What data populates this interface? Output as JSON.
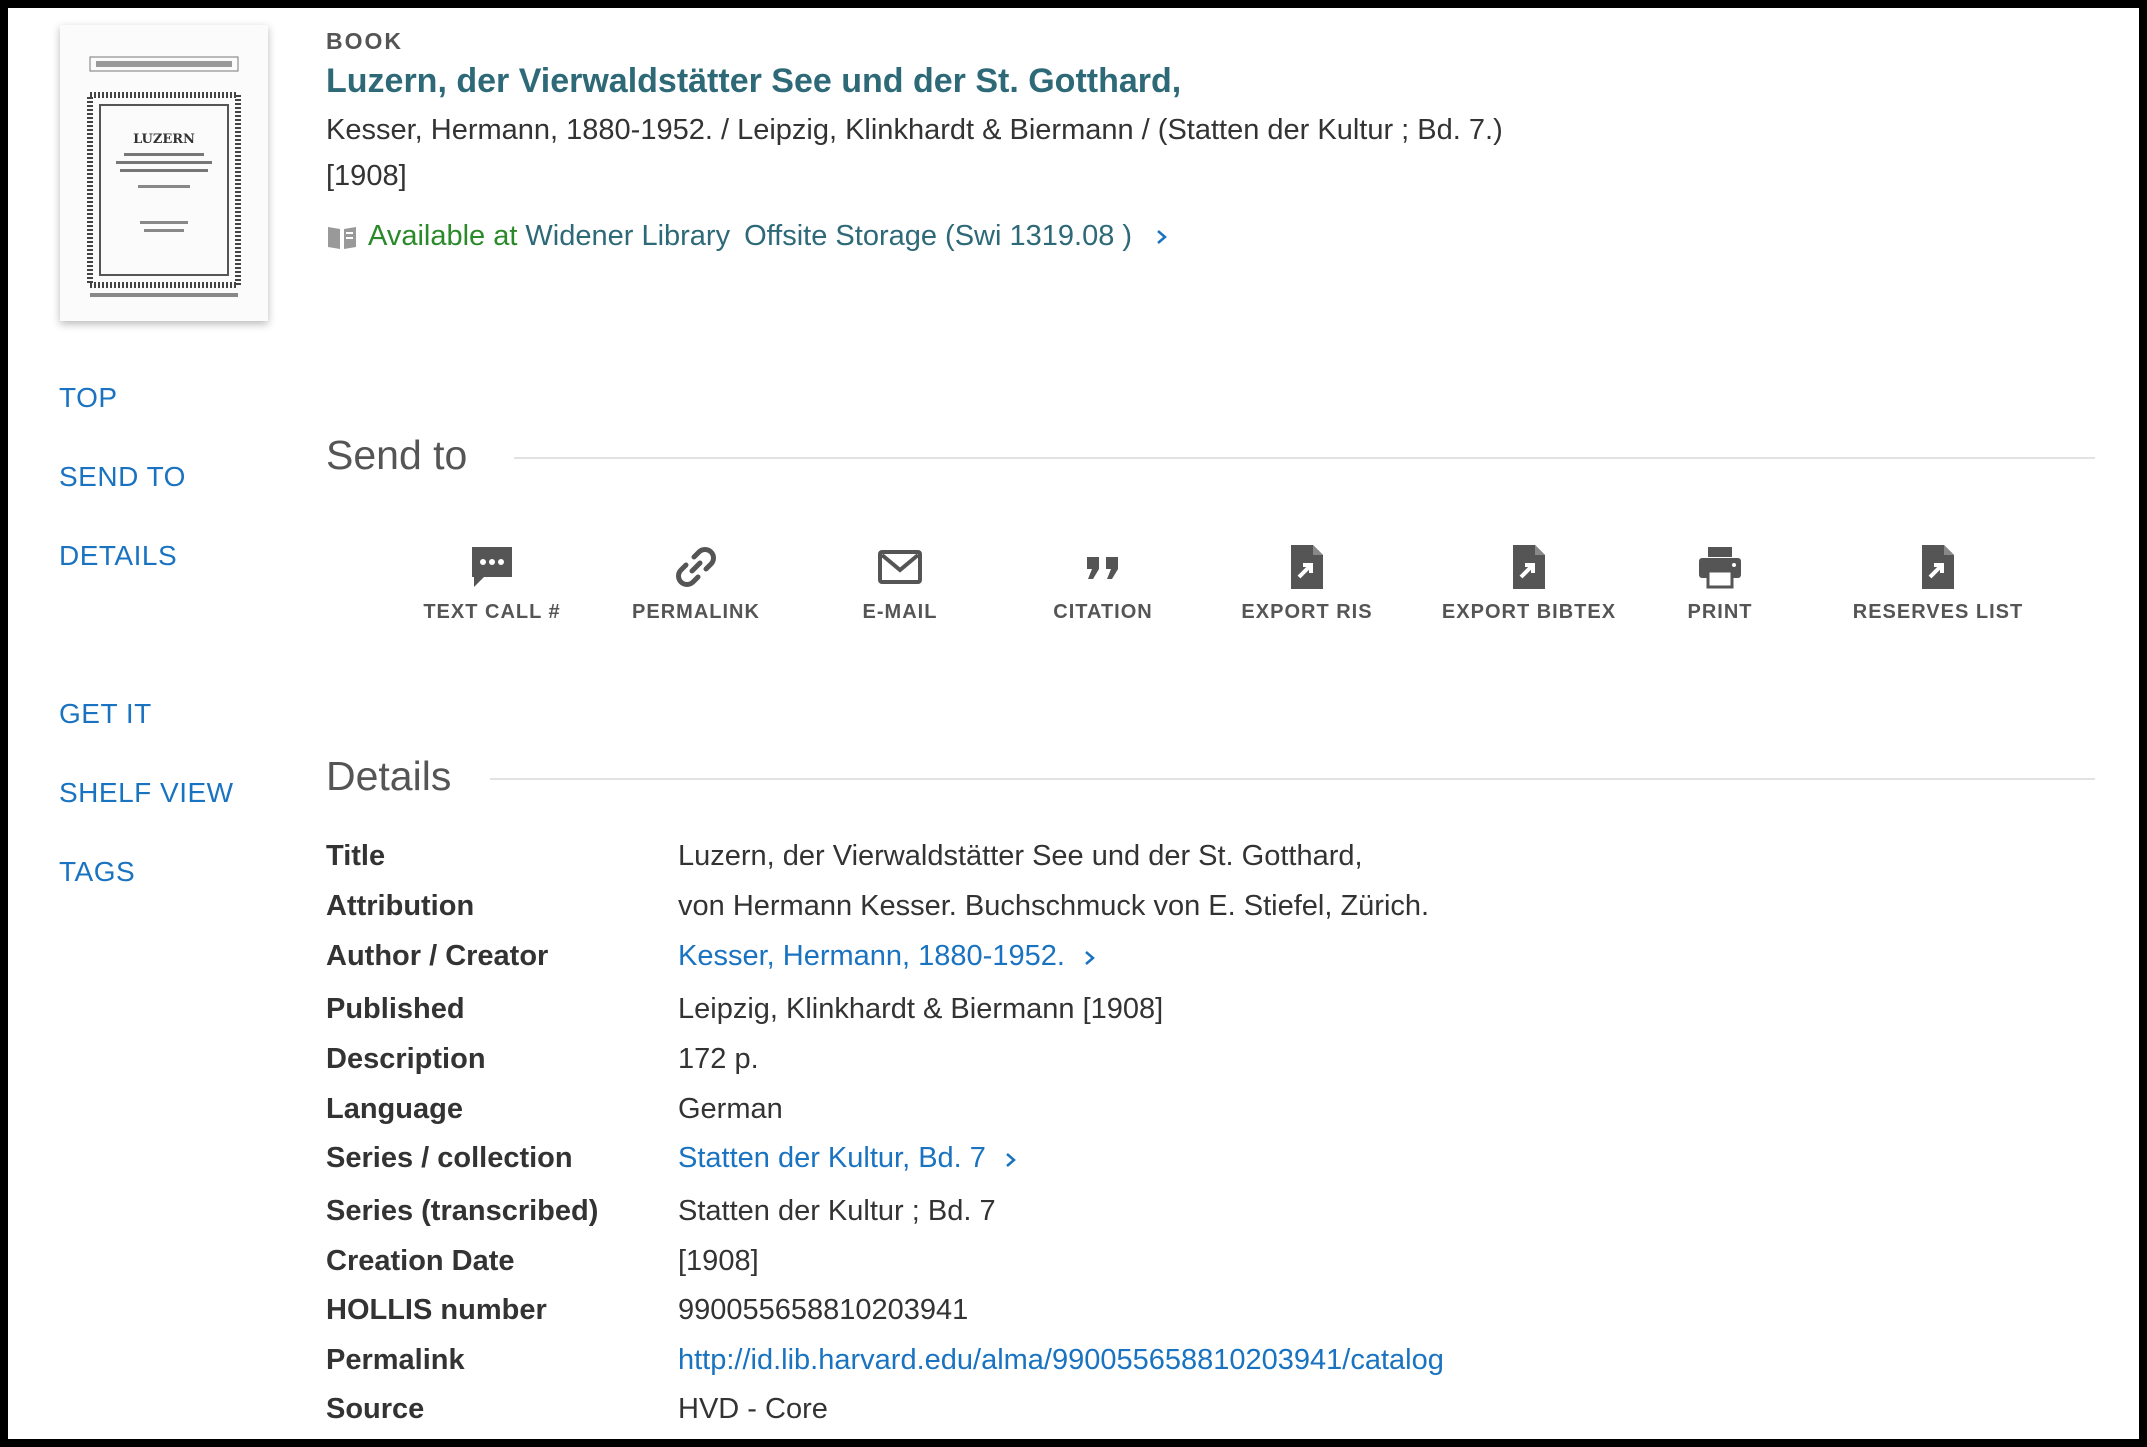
{
  "record": {
    "type": "BOOK",
    "title": "Luzern, der Vierwaldstätter See und der St. Gotthard,",
    "subline": "Kesser, Hermann, 1880-1952. / Leipzig, Klinkhardt & Biermann / (Statten der Kultur ; Bd. 7.)",
    "date": "[1908]",
    "availability": {
      "status": "Available at",
      "library": "Widener Library",
      "location": "Offsite Storage (Swi 1319.08 )"
    },
    "thumbnail_title": "LUZERN"
  },
  "nav": {
    "top": "TOP",
    "send_to": "SEND TO",
    "details": "DETAILS",
    "get_it": "GET IT",
    "shelf_view": "SHELF VIEW",
    "tags": "TAGS"
  },
  "send_to": {
    "heading": "Send to",
    "actions": [
      {
        "label": "TEXT CALL #",
        "icon": "chat-bubble-icon"
      },
      {
        "label": "PERMALINK",
        "icon": "link-icon"
      },
      {
        "label": "E-MAIL",
        "icon": "envelope-icon"
      },
      {
        "label": "CITATION",
        "icon": "quote-icon"
      },
      {
        "label": "EXPORT RIS",
        "icon": "file-export-icon"
      },
      {
        "label": "EXPORT BIBTEX",
        "icon": "file-export-icon"
      },
      {
        "label": "PRINT",
        "icon": "printer-icon"
      },
      {
        "label": "RESERVES LIST",
        "icon": "file-export-icon"
      }
    ]
  },
  "details": {
    "heading": "Details",
    "rows": [
      {
        "key": "Title",
        "value": "Luzern, der Vierwaldstätter See und der St. Gotthard,"
      },
      {
        "key": "Attribution",
        "value": "von Hermann Kesser. Buchschmuck von E. Stiefel, Zürich."
      },
      {
        "key": "Author / Creator",
        "value": "Kesser, Hermann, 1880-1952."
      },
      {
        "key": "Published",
        "value": "Leipzig, Klinkhardt & Biermann [1908]"
      },
      {
        "key": "Description",
        "value": "172 p."
      },
      {
        "key": "Language",
        "value": "German"
      },
      {
        "key": "Series / collection",
        "value": "Statten der Kultur, Bd. 7"
      },
      {
        "key": "Series (transcribed)",
        "value": "Statten der Kultur ; Bd. 7"
      },
      {
        "key": "Creation Date",
        "value": "[1908]"
      },
      {
        "key": "HOLLIS number",
        "value": "990055658810203941"
      },
      {
        "key": "Permalink",
        "value": "http://id.lib.harvard.edu/alma/990055658810203941/catalog"
      },
      {
        "key": "Source",
        "value": "HVD - Core"
      }
    ]
  },
  "colors": {
    "title_teal": "#2e6977",
    "link_blue": "#1a73c0",
    "available_green": "#2a8a2a"
  }
}
